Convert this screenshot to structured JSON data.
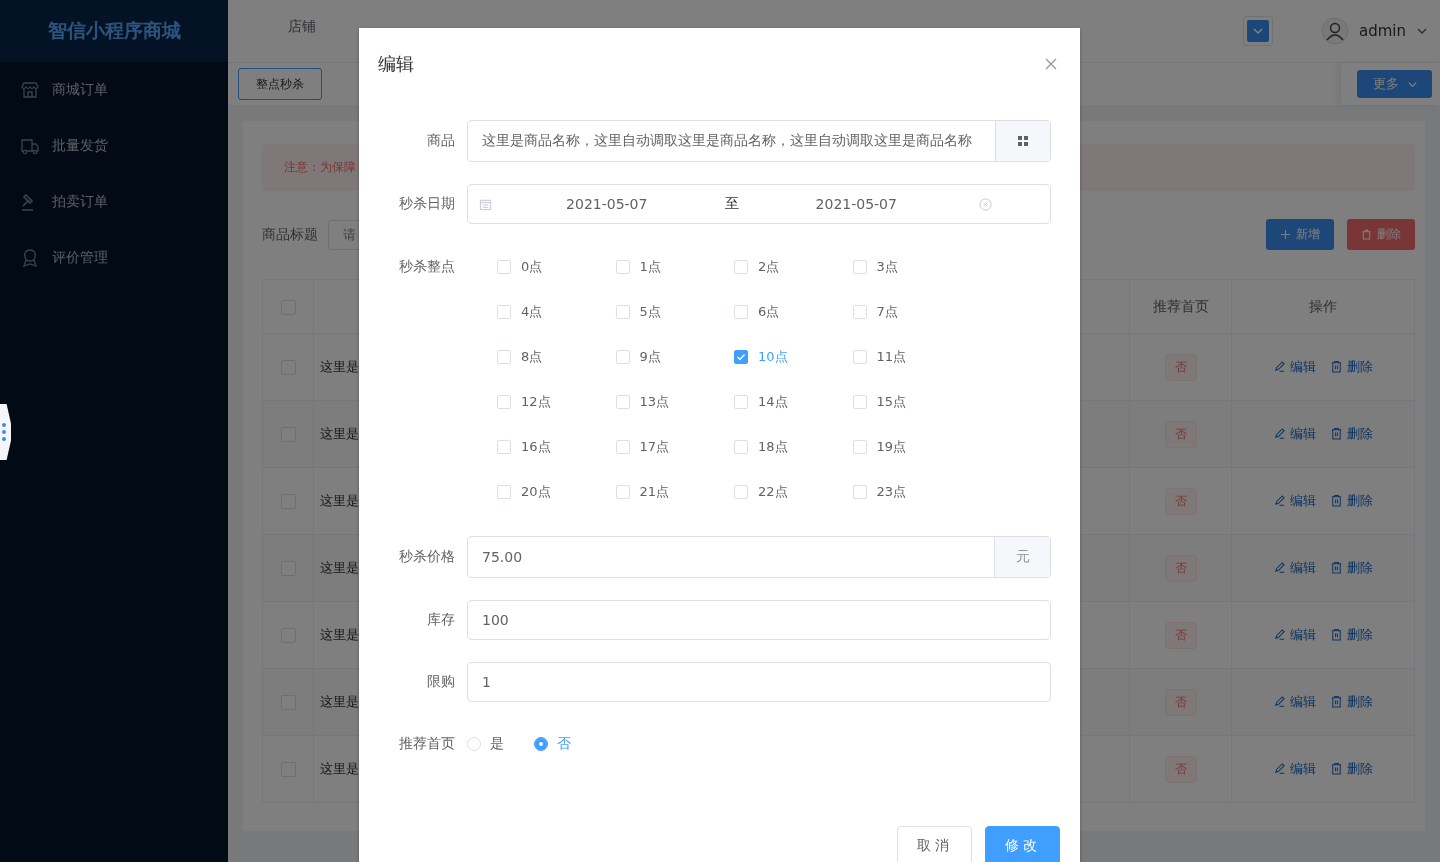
{
  "sidebar": {
    "logo": "智信小程序商城",
    "items": [
      {
        "label": "商城订单"
      },
      {
        "label": "批量发货"
      },
      {
        "label": "拍卖订单"
      },
      {
        "label": "评价管理"
      }
    ]
  },
  "topbar": {
    "nav": [
      {
        "label": "店铺",
        "selected": false
      }
    ],
    "user": "admin"
  },
  "subbar": {
    "tab": "整点秒杀",
    "more_button": "更多"
  },
  "content": {
    "notice": "注意：为保障",
    "search_label": "商品标题",
    "search_placeholder": "请",
    "add_button": "新增",
    "delete_button": "删除",
    "columns": [
      "推荐首页",
      "操作"
    ],
    "select_all_checked": false,
    "rows": [
      {
        "checked": false,
        "title": "这里是",
        "featured": "否",
        "edit": "编辑",
        "delete": "删除"
      },
      {
        "checked": false,
        "title": "这里是",
        "featured": "否",
        "edit": "编辑",
        "delete": "删除"
      },
      {
        "checked": false,
        "title": "这里是",
        "featured": "否",
        "edit": "编辑",
        "delete": "删除"
      },
      {
        "checked": false,
        "title": "这里是",
        "featured": "否",
        "edit": "编辑",
        "delete": "删除"
      },
      {
        "checked": false,
        "title": "这里是",
        "featured": "否",
        "edit": "编辑",
        "delete": "删除"
      },
      {
        "checked": false,
        "title": "这里是",
        "featured": "否",
        "edit": "编辑",
        "delete": "删除"
      },
      {
        "checked": false,
        "title": "这里是",
        "featured": "否",
        "edit": "编辑",
        "delete": "删除"
      }
    ]
  },
  "dialog": {
    "title": "编辑",
    "product": {
      "label": "商品",
      "value": "这里是商品名称，这里自动调取这里是商品名称，这里自动调取这里是商品名称"
    },
    "date": {
      "label": "秒杀日期",
      "start": "2021-05-07",
      "separator": "至",
      "end": "2021-05-07"
    },
    "hours": {
      "label": "秒杀整点",
      "options": [
        {
          "label": "0点",
          "checked": false
        },
        {
          "label": "1点",
          "checked": false
        },
        {
          "label": "2点",
          "checked": false
        },
        {
          "label": "3点",
          "checked": false
        },
        {
          "label": "4点",
          "checked": false
        },
        {
          "label": "5点",
          "checked": false
        },
        {
          "label": "6点",
          "checked": false
        },
        {
          "label": "7点",
          "checked": false
        },
        {
          "label": "8点",
          "checked": false
        },
        {
          "label": "9点",
          "checked": false
        },
        {
          "label": "10点",
          "checked": true
        },
        {
          "label": "11点",
          "checked": false
        },
        {
          "label": "12点",
          "checked": false
        },
        {
          "label": "13点",
          "checked": false
        },
        {
          "label": "14点",
          "checked": false
        },
        {
          "label": "15点",
          "checked": false
        },
        {
          "label": "16点",
          "checked": false
        },
        {
          "label": "17点",
          "checked": false
        },
        {
          "label": "18点",
          "checked": false
        },
        {
          "label": "19点",
          "checked": false
        },
        {
          "label": "20点",
          "checked": false
        },
        {
          "label": "21点",
          "checked": false
        },
        {
          "label": "22点",
          "checked": false
        },
        {
          "label": "23点",
          "checked": false
        }
      ]
    },
    "price": {
      "label": "秒杀价格",
      "value": "75.00",
      "unit": "元"
    },
    "stock": {
      "label": "库存",
      "value": "100"
    },
    "limit": {
      "label": "限购",
      "value": "1"
    },
    "featured": {
      "label": "推荐首页",
      "options": [
        {
          "label": "是",
          "selected": false
        },
        {
          "label": "否",
          "selected": true
        }
      ]
    },
    "buttons": {
      "cancel": "取消",
      "confirm": "修改"
    }
  }
}
